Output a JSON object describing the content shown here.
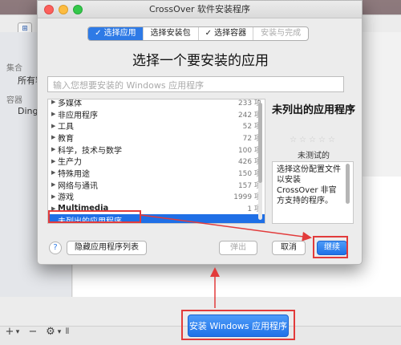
{
  "dialog": {
    "title": "CrossOver 软件安装程序",
    "steps": [
      {
        "label": "✓ 选择应用",
        "state": "active"
      },
      {
        "label": "选择安装包",
        "state": "normal"
      },
      {
        "label": "✓ 选择容器",
        "state": "normal"
      },
      {
        "label": "安装与完成",
        "state": "disabled"
      }
    ],
    "heading": "选择一个要安装的应用",
    "search_placeholder": "输入您想要安装的 Windows 应用程序",
    "categories": [
      {
        "name": "多媒体",
        "count": "233 项"
      },
      {
        "name": "非应用程序",
        "count": "242 项"
      },
      {
        "name": "工具",
        "count": "52 项"
      },
      {
        "name": "教育",
        "count": "72 项"
      },
      {
        "name": "科学，技术与数学",
        "count": "100 项"
      },
      {
        "name": "生产力",
        "count": "426 项"
      },
      {
        "name": "特殊用途",
        "count": "150 项"
      },
      {
        "name": "网络与通讯",
        "count": "157 项"
      },
      {
        "name": "游戏",
        "count": "1999 项"
      },
      {
        "name": "Multimedia",
        "count": "1 项"
      },
      {
        "name": "未列出的应用程序",
        "count": ""
      }
    ],
    "side_panel": {
      "title": "未列出的应用程序",
      "stars": "☆☆☆☆☆",
      "rating_label": "未测试的",
      "description": "选择这份配置文件以安装 CrossOver 非官方支持的程序。"
    },
    "buttons": {
      "help": "?",
      "hide_list": "隐藏应用程序列表",
      "eject": "弹出",
      "cancel": "取消",
      "continue": "继续"
    }
  },
  "background": {
    "toolbar_icon": "⊞",
    "sidebar": [
      {
        "label": "集合",
        "type": "section"
      },
      {
        "label": "所有容",
        "type": "item"
      },
      {
        "label": "容器",
        "type": "section"
      },
      {
        "label": "DingT",
        "type": "item"
      }
    ],
    "bottom_controls": [
      "+",
      "▾",
      "−",
      "⚙",
      "▾",
      "⦀"
    ],
    "install_button": "安装 Windows 应用程序"
  },
  "colors": {
    "accent": "#1f6fe6",
    "highlight_annotation": "#e23b3b"
  }
}
